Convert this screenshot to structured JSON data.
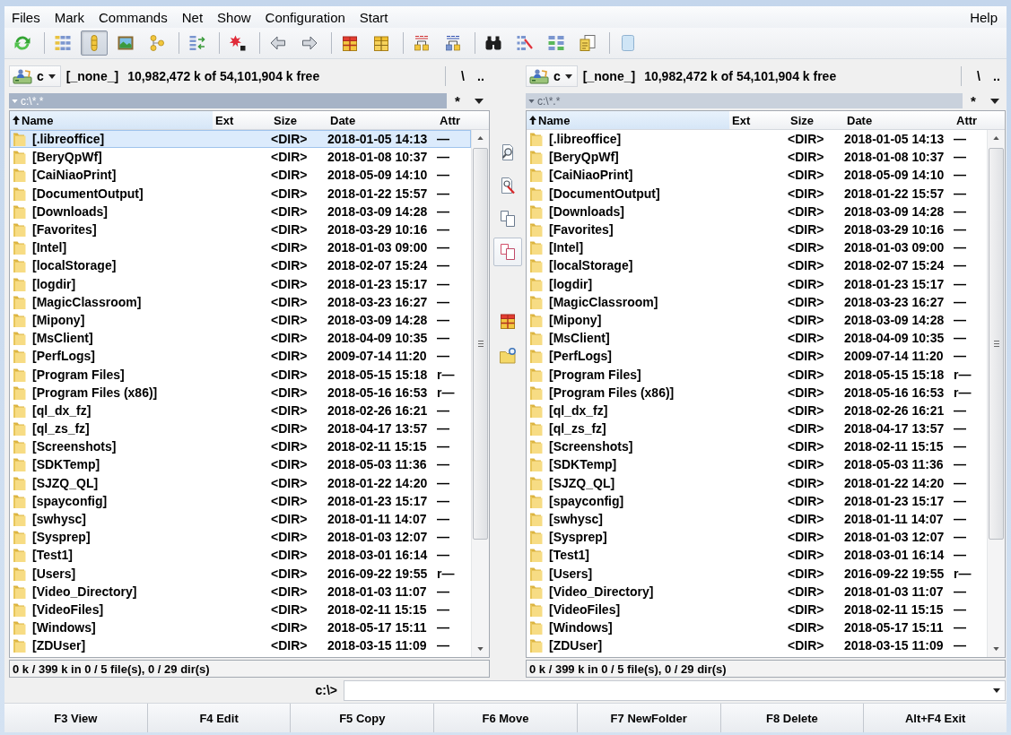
{
  "menu": {
    "left": [
      "Files",
      "Mark",
      "Commands",
      "Net",
      "Show",
      "Configuration",
      "Start"
    ],
    "right": [
      "Help"
    ]
  },
  "toolbar": {
    "groups": [
      [
        {
          "selected": false
        }
      ],
      [
        {
          "selected": false
        },
        {
          "selected": true
        },
        {
          "selected": false
        },
        {
          "selected": false
        }
      ],
      [
        {
          "selected": false
        }
      ],
      [
        {
          "selected": false
        }
      ],
      [
        {
          "selected": false
        },
        {
          "selected": false
        }
      ],
      [
        {
          "selected": false
        },
        {
          "selected": false
        }
      ],
      [
        {
          "selected": false
        },
        {
          "selected": false
        }
      ],
      [
        {
          "selected": false
        },
        {
          "selected": false
        },
        {
          "selected": false
        },
        {
          "selected": false
        }
      ],
      [
        {
          "selected": false
        }
      ]
    ]
  },
  "panels": [
    {
      "active": true,
      "drive": {
        "letter": "c",
        "label": "[_none_]",
        "free": "10,982,472 k of 54,101,904 k free"
      },
      "nav_buttons": [
        "\\",
        ".."
      ],
      "path": "c:\\*.*",
      "path_buttons": [
        "*"
      ],
      "columns": [
        {
          "label": "Name",
          "sorted": true
        },
        {
          "label": "Ext",
          "sorted": false
        },
        {
          "label": "Size",
          "sorted": false
        },
        {
          "label": "Date",
          "sorted": false
        },
        {
          "label": "Attr",
          "sorted": false
        }
      ],
      "rows": [
        {
          "name": "[.libreoffice]",
          "size": "<DIR>",
          "date": "2018-01-05 14:13",
          "attr": "—",
          "selected": true
        },
        {
          "name": "[BeryQpWf]",
          "size": "<DIR>",
          "date": "2018-01-08 10:37",
          "attr": "—",
          "selected": false
        },
        {
          "name": "[CaiNiaoPrint]",
          "size": "<DIR>",
          "date": "2018-05-09 14:10",
          "attr": "—",
          "selected": false
        },
        {
          "name": "[DocumentOutput]",
          "size": "<DIR>",
          "date": "2018-01-22 15:57",
          "attr": "—",
          "selected": false
        },
        {
          "name": "[Downloads]",
          "size": "<DIR>",
          "date": "2018-03-09 14:28",
          "attr": "—",
          "selected": false
        },
        {
          "name": "[Favorites]",
          "size": "<DIR>",
          "date": "2018-03-29 10:16",
          "attr": "—",
          "selected": false
        },
        {
          "name": "[Intel]",
          "size": "<DIR>",
          "date": "2018-01-03 09:00",
          "attr": "—",
          "selected": false
        },
        {
          "name": "[localStorage]",
          "size": "<DIR>",
          "date": "2018-02-07 15:24",
          "attr": "—",
          "selected": false
        },
        {
          "name": "[logdir]",
          "size": "<DIR>",
          "date": "2018-01-23 15:17",
          "attr": "—",
          "selected": false
        },
        {
          "name": "[MagicClassroom]",
          "size": "<DIR>",
          "date": "2018-03-23 16:27",
          "attr": "—",
          "selected": false
        },
        {
          "name": "[Mipony]",
          "size": "<DIR>",
          "date": "2018-03-09 14:28",
          "attr": "—",
          "selected": false
        },
        {
          "name": "[MsClient]",
          "size": "<DIR>",
          "date": "2018-04-09 10:35",
          "attr": "—",
          "selected": false
        },
        {
          "name": "[PerfLogs]",
          "size": "<DIR>",
          "date": "2009-07-14 11:20",
          "attr": "—",
          "selected": false
        },
        {
          "name": "[Program Files]",
          "size": "<DIR>",
          "date": "2018-05-15 15:18",
          "attr": "r—",
          "selected": false
        },
        {
          "name": "[Program Files (x86)]",
          "size": "<DIR>",
          "date": "2018-05-16 16:53",
          "attr": "r—",
          "selected": false
        },
        {
          "name": "[ql_dx_fz]",
          "size": "<DIR>",
          "date": "2018-02-26 16:21",
          "attr": "—",
          "selected": false
        },
        {
          "name": "[ql_zs_fz]",
          "size": "<DIR>",
          "date": "2018-04-17 13:57",
          "attr": "—",
          "selected": false
        },
        {
          "name": "[Screenshots]",
          "size": "<DIR>",
          "date": "2018-02-11 15:15",
          "attr": "—",
          "selected": false
        },
        {
          "name": "[SDKTemp]",
          "size": "<DIR>",
          "date": "2018-05-03 11:36",
          "attr": "—",
          "selected": false
        },
        {
          "name": "[SJZQ_QL]",
          "size": "<DIR>",
          "date": "2018-01-22 14:20",
          "attr": "—",
          "selected": false
        },
        {
          "name": "[spayconfig]",
          "size": "<DIR>",
          "date": "2018-01-23 15:17",
          "attr": "—",
          "selected": false
        },
        {
          "name": "[swhysc]",
          "size": "<DIR>",
          "date": "2018-01-11 14:07",
          "attr": "—",
          "selected": false
        },
        {
          "name": "[Sysprep]",
          "size": "<DIR>",
          "date": "2018-01-03 12:07",
          "attr": "—",
          "selected": false
        },
        {
          "name": "[Test1]",
          "size": "<DIR>",
          "date": "2018-03-01 16:14",
          "attr": "—",
          "selected": false
        },
        {
          "name": "[Users]",
          "size": "<DIR>",
          "date": "2016-09-22 19:55",
          "attr": "r—",
          "selected": false
        },
        {
          "name": "[Video_Directory]",
          "size": "<DIR>",
          "date": "2018-01-03 11:07",
          "attr": "—",
          "selected": false
        },
        {
          "name": "[VideoFiles]",
          "size": "<DIR>",
          "date": "2018-02-11 15:15",
          "attr": "—",
          "selected": false
        },
        {
          "name": "[Windows]",
          "size": "<DIR>",
          "date": "2018-05-17 15:11",
          "attr": "—",
          "selected": false
        },
        {
          "name": "[ZDUser]",
          "size": "<DIR>",
          "date": "2018-03-15 11:09",
          "attr": "—",
          "selected": false
        }
      ],
      "status": "0 k / 399 k in 0 / 5 file(s), 0 / 29 dir(s)"
    },
    {
      "active": false,
      "drive": {
        "letter": "c",
        "label": "[_none_]",
        "free": "10,982,472 k of 54,101,904 k free"
      },
      "nav_buttons": [
        "\\",
        ".."
      ],
      "path": "c:\\*.*",
      "path_buttons": [
        "*"
      ],
      "columns": [
        {
          "label": "Name",
          "sorted": true
        },
        {
          "label": "Ext",
          "sorted": false
        },
        {
          "label": "Size",
          "sorted": false
        },
        {
          "label": "Date",
          "sorted": false
        },
        {
          "label": "Attr",
          "sorted": false
        }
      ],
      "rows": [
        {
          "name": "[.libreoffice]",
          "size": "<DIR>",
          "date": "2018-01-05 14:13",
          "attr": "—",
          "selected": false
        },
        {
          "name": "[BeryQpWf]",
          "size": "<DIR>",
          "date": "2018-01-08 10:37",
          "attr": "—",
          "selected": false
        },
        {
          "name": "[CaiNiaoPrint]",
          "size": "<DIR>",
          "date": "2018-05-09 14:10",
          "attr": "—",
          "selected": false
        },
        {
          "name": "[DocumentOutput]",
          "size": "<DIR>",
          "date": "2018-01-22 15:57",
          "attr": "—",
          "selected": false
        },
        {
          "name": "[Downloads]",
          "size": "<DIR>",
          "date": "2018-03-09 14:28",
          "attr": "—",
          "selected": false
        },
        {
          "name": "[Favorites]",
          "size": "<DIR>",
          "date": "2018-03-29 10:16",
          "attr": "—",
          "selected": false
        },
        {
          "name": "[Intel]",
          "size": "<DIR>",
          "date": "2018-01-03 09:00",
          "attr": "—",
          "selected": false
        },
        {
          "name": "[localStorage]",
          "size": "<DIR>",
          "date": "2018-02-07 15:24",
          "attr": "—",
          "selected": false
        },
        {
          "name": "[logdir]",
          "size": "<DIR>",
          "date": "2018-01-23 15:17",
          "attr": "—",
          "selected": false
        },
        {
          "name": "[MagicClassroom]",
          "size": "<DIR>",
          "date": "2018-03-23 16:27",
          "attr": "—",
          "selected": false
        },
        {
          "name": "[Mipony]",
          "size": "<DIR>",
          "date": "2018-03-09 14:28",
          "attr": "—",
          "selected": false
        },
        {
          "name": "[MsClient]",
          "size": "<DIR>",
          "date": "2018-04-09 10:35",
          "attr": "—",
          "selected": false
        },
        {
          "name": "[PerfLogs]",
          "size": "<DIR>",
          "date": "2009-07-14 11:20",
          "attr": "—",
          "selected": false
        },
        {
          "name": "[Program Files]",
          "size": "<DIR>",
          "date": "2018-05-15 15:18",
          "attr": "r—",
          "selected": false
        },
        {
          "name": "[Program Files (x86)]",
          "size": "<DIR>",
          "date": "2018-05-16 16:53",
          "attr": "r—",
          "selected": false
        },
        {
          "name": "[ql_dx_fz]",
          "size": "<DIR>",
          "date": "2018-02-26 16:21",
          "attr": "—",
          "selected": false
        },
        {
          "name": "[ql_zs_fz]",
          "size": "<DIR>",
          "date": "2018-04-17 13:57",
          "attr": "—",
          "selected": false
        },
        {
          "name": "[Screenshots]",
          "size": "<DIR>",
          "date": "2018-02-11 15:15",
          "attr": "—",
          "selected": false
        },
        {
          "name": "[SDKTemp]",
          "size": "<DIR>",
          "date": "2018-05-03 11:36",
          "attr": "—",
          "selected": false
        },
        {
          "name": "[SJZQ_QL]",
          "size": "<DIR>",
          "date": "2018-01-22 14:20",
          "attr": "—",
          "selected": false
        },
        {
          "name": "[spayconfig]",
          "size": "<DIR>",
          "date": "2018-01-23 15:17",
          "attr": "—",
          "selected": false
        },
        {
          "name": "[swhysc]",
          "size": "<DIR>",
          "date": "2018-01-11 14:07",
          "attr": "—",
          "selected": false
        },
        {
          "name": "[Sysprep]",
          "size": "<DIR>",
          "date": "2018-01-03 12:07",
          "attr": "—",
          "selected": false
        },
        {
          "name": "[Test1]",
          "size": "<DIR>",
          "date": "2018-03-01 16:14",
          "attr": "—",
          "selected": false
        },
        {
          "name": "[Users]",
          "size": "<DIR>",
          "date": "2016-09-22 19:55",
          "attr": "r—",
          "selected": false
        },
        {
          "name": "[Video_Directory]",
          "size": "<DIR>",
          "date": "2018-01-03 11:07",
          "attr": "—",
          "selected": false
        },
        {
          "name": "[VideoFiles]",
          "size": "<DIR>",
          "date": "2018-02-11 15:15",
          "attr": "—",
          "selected": false
        },
        {
          "name": "[Windows]",
          "size": "<DIR>",
          "date": "2018-05-17 15:11",
          "attr": "—",
          "selected": false
        },
        {
          "name": "[ZDUser]",
          "size": "<DIR>",
          "date": "2018-03-15 11:09",
          "attr": "—",
          "selected": false
        }
      ],
      "status": "0 k / 399 k in 0 / 5 file(s), 0 / 29 dir(s)"
    }
  ],
  "middle_toolbar": {
    "groups": [
      [
        {
          "selected": false
        },
        {
          "selected": false
        },
        {
          "selected": false
        },
        {
          "selected": true
        }
      ],
      [
        {
          "selected": false
        },
        {
          "selected": false
        }
      ]
    ]
  },
  "command_line": {
    "prompt": "c:\\>"
  },
  "function_keys": [
    "F3 View",
    "F4 Edit",
    "F5 Copy",
    "F6 Move",
    "F7 NewFolder",
    "F8 Delete",
    "Alt+F4 Exit"
  ]
}
